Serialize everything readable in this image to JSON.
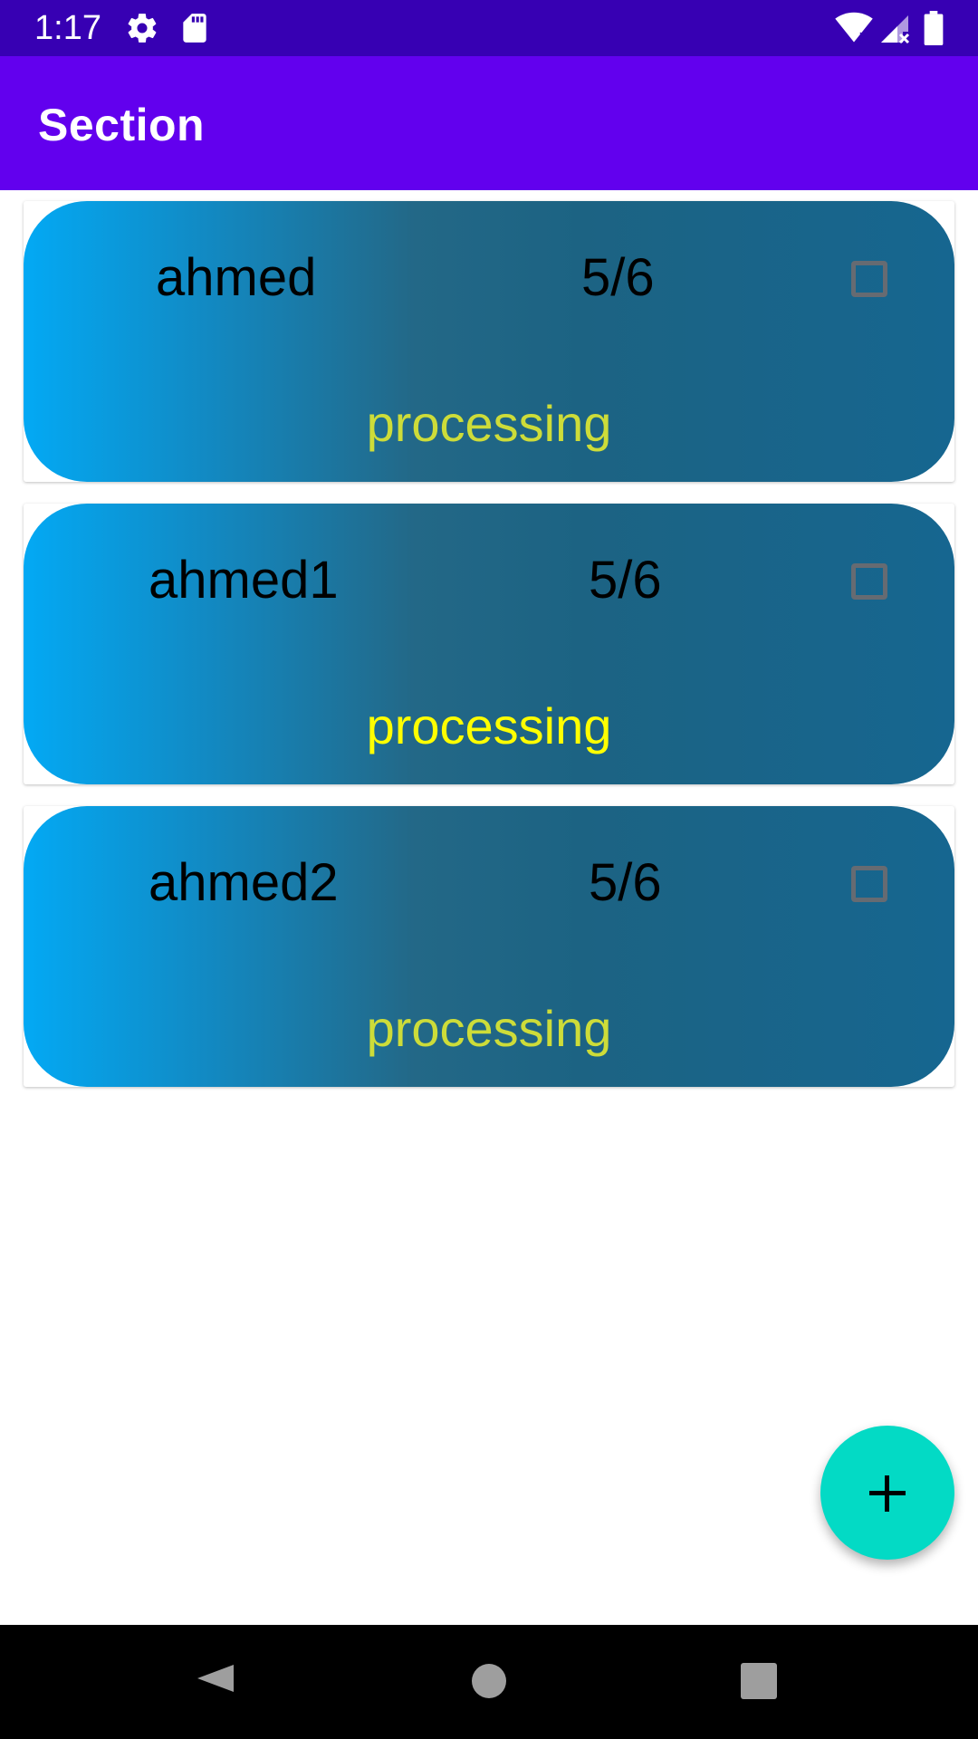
{
  "status_bar": {
    "time": "1:17",
    "icons": [
      "settings-icon",
      "sd-card-icon",
      "wifi-icon",
      "signal-icon",
      "battery-icon"
    ]
  },
  "app_bar": {
    "title": "Section"
  },
  "cards": [
    {
      "name": "ahmed",
      "score": "5/6",
      "status": "processing",
      "status_color": "#cddc39",
      "checked": false
    },
    {
      "name": "ahmed1",
      "score": "5/6",
      "status": "processing",
      "status_color": "#ffff00",
      "checked": false
    },
    {
      "name": "ahmed2",
      "score": "5/6",
      "status": "processing",
      "status_color": "#cddc39",
      "checked": false
    }
  ],
  "fab": {
    "icon": "plus-icon"
  },
  "nav_bar": {
    "buttons": [
      "back-icon",
      "home-icon",
      "recents-icon"
    ]
  },
  "colors": {
    "status_bar": "#3700b3",
    "app_bar": "#6200ee",
    "fab": "#03dac5",
    "card_gradient_start": "#03a9f4",
    "card_gradient_end": "#166690"
  }
}
